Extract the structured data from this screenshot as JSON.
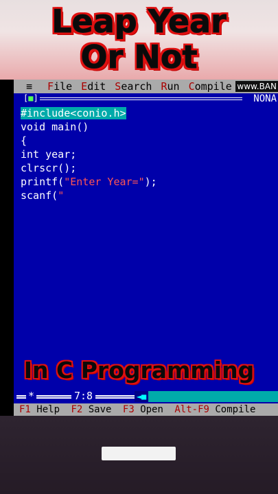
{
  "banner": {
    "title_line1": "Leap Year",
    "title_line2": "Or Not"
  },
  "menubar": {
    "system_icon": "≡",
    "items": [
      {
        "hot": "F",
        "rest": "ile"
      },
      {
        "hot": "E",
        "rest": "dit"
      },
      {
        "hot": "S",
        "rest": "earch"
      },
      {
        "hot": "R",
        "rest": "un"
      },
      {
        "hot": "C",
        "rest": "ompile"
      }
    ],
    "watermark": "www.BAN"
  },
  "editor": {
    "close_box_left": "[",
    "close_box_mark": "■",
    "close_box_right": "]",
    "filename": "NONA",
    "code": {
      "line1": "#include<conio.h>",
      "line2": "void main()",
      "line3": "{",
      "line4": "int year;",
      "line5": "clrscr();",
      "line6_pre": "printf(",
      "line6_str": "\"Enter Year=\"",
      "line6_post": ");",
      "line7_pre": "scanf(",
      "line7_str": "\""
    }
  },
  "status": {
    "modified": "*",
    "cursor": "7:8",
    "scroll_arrow": "◄■"
  },
  "fkeys": [
    {
      "key": "F1",
      "label": "Help"
    },
    {
      "key": "F2",
      "label": "Save"
    },
    {
      "key": "F3",
      "label": "Open"
    },
    {
      "key": "Alt-F9",
      "label": "Compile"
    }
  ],
  "caption": "In C Programming",
  "colors": {
    "ide_background": "#0000aa",
    "menubar": "#aaaaaa",
    "highlight": "#00aaaa",
    "string": "#ff5555",
    "title_outline": "#e01010"
  }
}
